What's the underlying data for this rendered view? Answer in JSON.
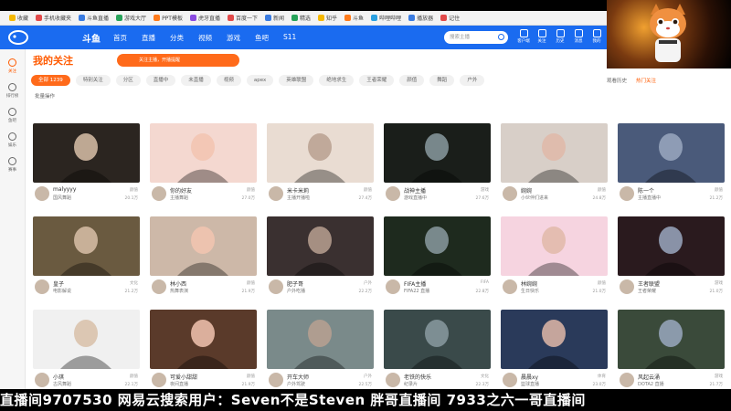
{
  "bookmarks": [
    "收藏",
    "手机收藏夹",
    "斗鱼直播",
    "游戏大厅",
    "PPT模板",
    "虎牙直播",
    "百度一下",
    "新闻",
    "精选",
    "知乎",
    "斗鱼",
    "哔哩哔哩",
    "播放器",
    "记住"
  ],
  "header": {
    "logo": "斗鱼",
    "brand": "斗鱼",
    "nav": [
      "首页",
      "直播",
      "分类",
      "视频",
      "游戏",
      "鱼吧",
      "S11"
    ],
    "search_placeholder": "搜索主播",
    "icons": [
      {
        "name": "download-icon",
        "label": "客户端"
      },
      {
        "name": "follow-icon",
        "label": "关注"
      },
      {
        "name": "history-icon",
        "label": "历史"
      },
      {
        "name": "message-icon",
        "label": "消息"
      },
      {
        "name": "profile-icon",
        "label": "我的"
      }
    ]
  },
  "rail": [
    {
      "name": "follow",
      "label": "关注",
      "active": true
    },
    {
      "name": "rank",
      "label": "排行榜",
      "active": false
    },
    {
      "name": "fish",
      "label": "鱼吧",
      "active": false
    },
    {
      "name": "entertainment",
      "label": "娱乐",
      "active": false
    },
    {
      "name": "game",
      "label": "赛事",
      "active": false
    }
  ],
  "main": {
    "title": "我的关注",
    "promo": "关注主播，开播提醒"
  },
  "filters": [
    "全部 1239",
    "特别关注",
    "分区",
    "直播中",
    "未直播",
    "视频",
    "apex",
    "英雄联盟",
    "绝地求生",
    "王者荣耀",
    "颜值",
    "舞蹈",
    "户外"
  ],
  "manage_label": "批量操作",
  "right_links": {
    "history": "观看历史",
    "hot": "热门关注"
  },
  "cards": [
    {
      "name": "malyyyy",
      "title": "国风舞蹈",
      "cat": "颜值",
      "views": "20.1万",
      "bg": "#2b2520"
    },
    {
      "name": "你的好友",
      "title": "主播舞蹈",
      "cat": "颜值",
      "views": "27.0万",
      "bg": "#f4d8d0"
    },
    {
      "name": "米卡米莉",
      "title": "主播开播啦",
      "cat": "颜值",
      "views": "27.4万",
      "bg": "#e9dcd2"
    },
    {
      "name": "战神主播",
      "title": "游戏直播中",
      "cat": "游戏",
      "views": "27.6万",
      "bg": "#1a1e1a"
    },
    {
      "name": "婉婉",
      "title": "小伙伴们进来",
      "cat": "颜值",
      "views": "24.8万",
      "bg": "#d8cfc8"
    },
    {
      "name": "陈一个",
      "title": "主播直播中",
      "cat": "颜值",
      "views": "21.2万",
      "bg": "#4a5a7a"
    },
    {
      "name": "皇子",
      "title": "电影解说",
      "cat": "文化",
      "views": "21.2万",
      "bg": "#6a5a40"
    },
    {
      "name": "林小西",
      "title": "热舞表演",
      "cat": "颜值",
      "views": "21.9万",
      "bg": "#cdb8a8"
    },
    {
      "name": "肥子哥",
      "title": "户外吃播",
      "cat": "户外",
      "views": "22.2万",
      "bg": "#3a3030"
    },
    {
      "name": "FIFA主播",
      "title": "FIFA22 直播",
      "cat": "FIFA",
      "views": "22.8万",
      "bg": "#1e2a1e"
    },
    {
      "name": "林婉婉",
      "title": "生日快乐",
      "cat": "颜值",
      "views": "21.0万",
      "bg": "#f6d4e0"
    },
    {
      "name": "王者联盟",
      "title": "王者荣耀",
      "cat": "游戏",
      "views": "21.0万",
      "bg": "#2a1a1e"
    },
    {
      "name": "小琪",
      "title": "古风舞蹈",
      "cat": "颜值",
      "views": "22.1万",
      "bg": "#f0f0f0"
    },
    {
      "name": "可爱小甜甜",
      "title": "夜间直播",
      "cat": "颜值",
      "views": "21.9万",
      "bg": "#5a3a2a"
    },
    {
      "name": "开车大师",
      "title": "户外驾驶",
      "cat": "户外",
      "views": "22.5万",
      "bg": "#7a8a8a"
    },
    {
      "name": "老铁的快乐",
      "title": "纪录片",
      "cat": "文化",
      "views": "22.3万",
      "bg": "#3a4a4a"
    },
    {
      "name": "晨晨xy",
      "title": "篮球直播",
      "cat": "体育",
      "views": "23.0万",
      "bg": "#2a3a5a"
    },
    {
      "name": "风起云涌",
      "title": "DOTA2 直播",
      "cat": "游戏",
      "views": "21.7万",
      "bg": "#3a4a3a"
    }
  ],
  "marquee": "直播间9707530  网易云搜索用户：Seven不是Steven  胖哥直播间 7933之六一哥直播间"
}
